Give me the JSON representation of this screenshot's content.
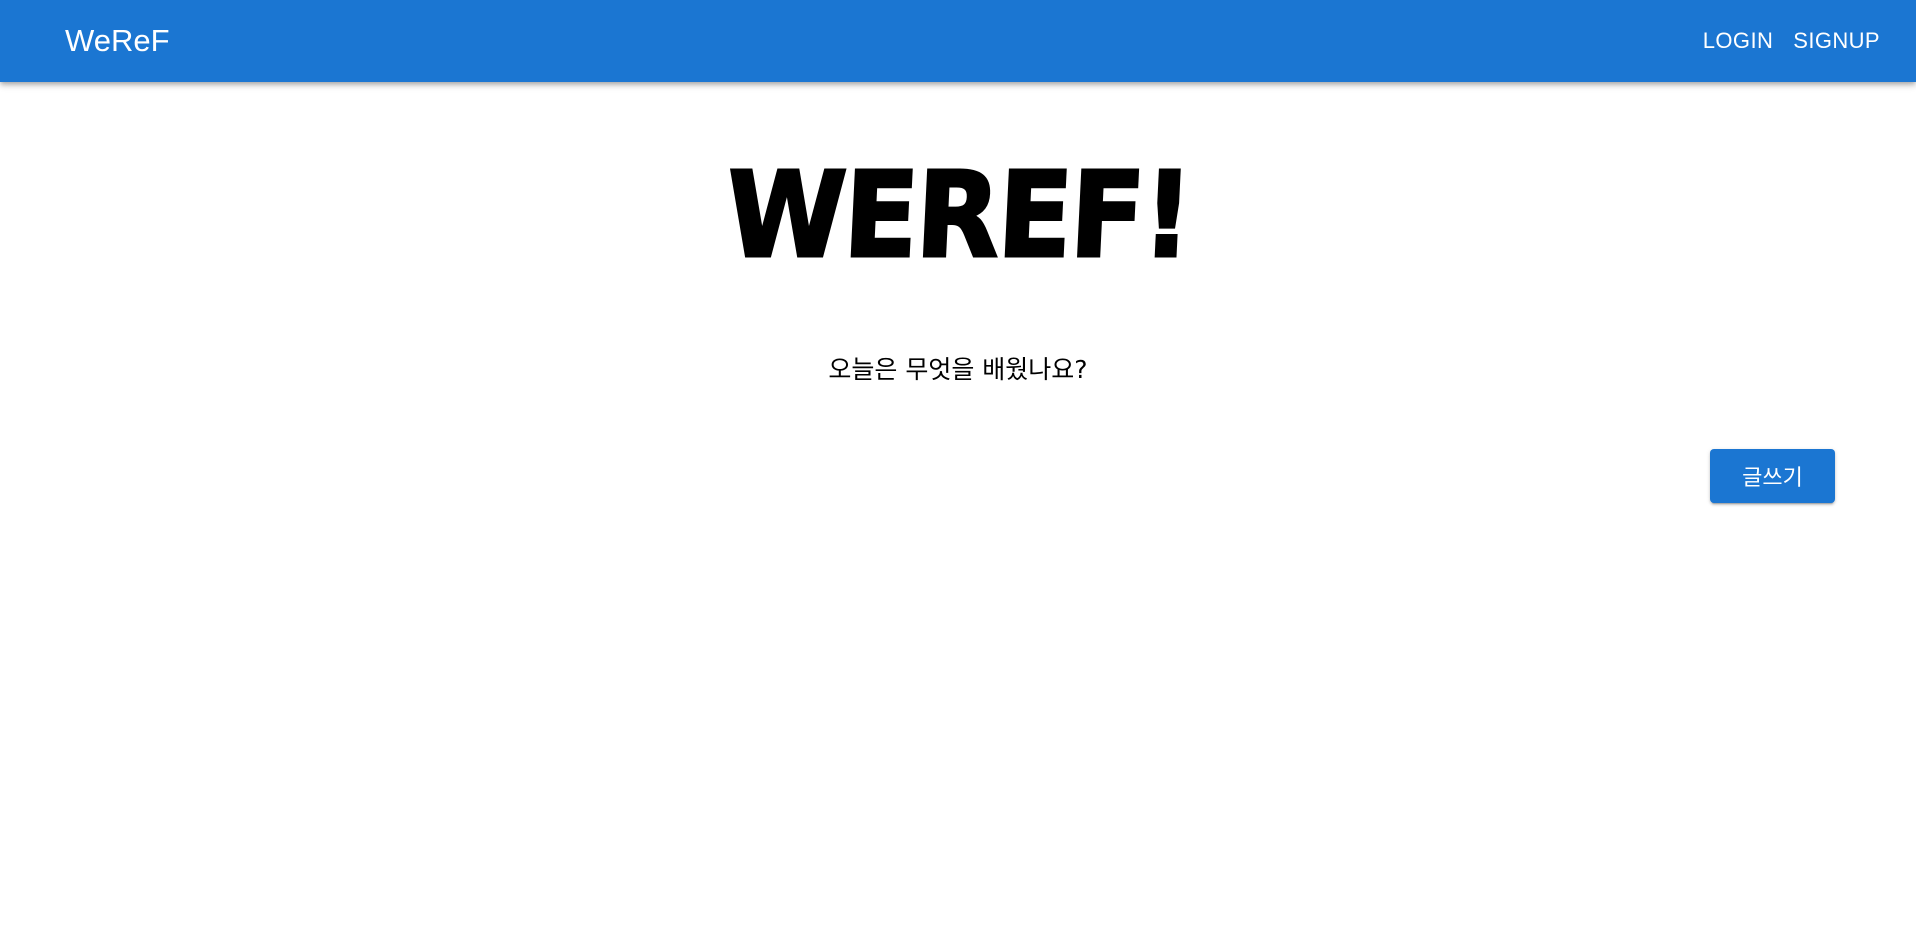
{
  "appbar": {
    "brand": "WeReF",
    "nav": {
      "login": "LOGIN",
      "signup": "SIGNUP"
    },
    "color": "#1b76d2"
  },
  "main": {
    "title": "WEREF!",
    "subtitle": "오늘은 무엇을 배웠나요?",
    "write_button": "글쓰기"
  }
}
